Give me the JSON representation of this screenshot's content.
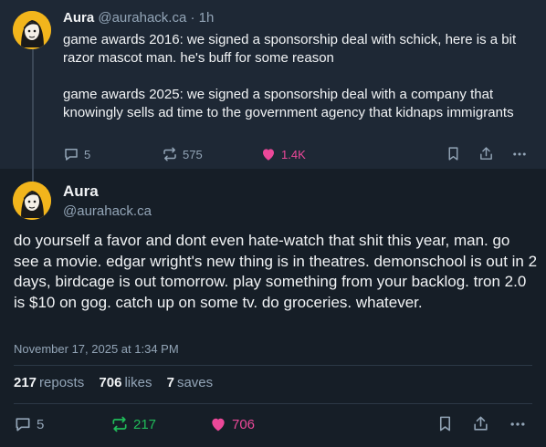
{
  "parent_post": {
    "author_name": "Aura",
    "author_handle": "@aurahack.ca",
    "separator": "·",
    "time": "1h",
    "paragraphs": [
      "game awards 2016: we signed a sponsorship deal with schick, here is a bit razor mascot man. he's buff for some reason",
      "game awards 2025: we signed a sponsorship deal with a company that knowingly sells ad time to the government agency that kidnaps immigrants"
    ],
    "actions": {
      "replies": "5",
      "reposts": "575",
      "likes": "1.4K"
    }
  },
  "main_post": {
    "author_name": "Aura",
    "author_handle": "@aurahack.ca",
    "text": "do yourself a favor and dont even hate-watch that shit this year, man. go see a movie. edgar wright's new thing is in theatres. demonschool is out in 2 days, birdcage is out tomorrow. play something from your backlog. tron 2.0 is $10 on gog. catch up on some tv. do groceries. whatever.",
    "date": "November 17, 2025 at 1:34 PM",
    "stats": {
      "reposts_count": "217",
      "reposts_label": "reposts",
      "likes_count": "706",
      "likes_label": "likes",
      "saves_count": "7",
      "saves_label": "saves"
    },
    "actions": {
      "replies": "5",
      "reposts": "217",
      "likes": "706"
    }
  },
  "colors": {
    "background": "#161e27",
    "parent_background": "#1e2835",
    "muted_text": "#93a5b7",
    "repost_active": "#20bc5a",
    "like_active": "#ec4899",
    "avatar_bg": "#f2b51c"
  },
  "icons": [
    "reply-icon",
    "repost-icon",
    "heart-icon",
    "bookmark-icon",
    "share-icon",
    "more-icon"
  ]
}
